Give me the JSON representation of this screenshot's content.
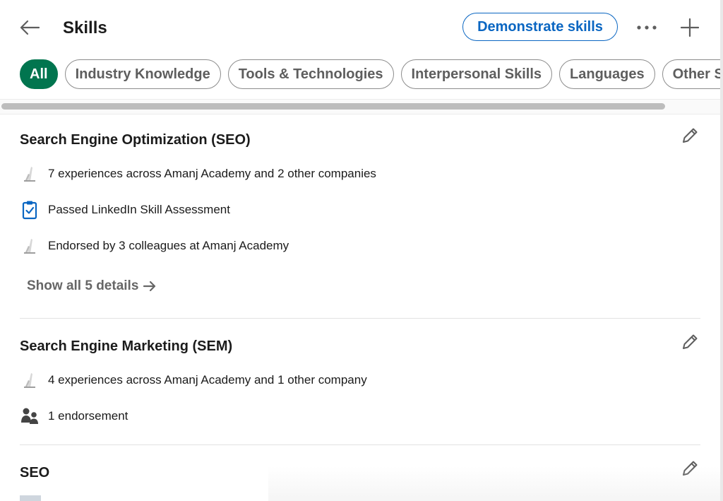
{
  "header": {
    "title": "Skills",
    "demonstrate_label": "Demonstrate skills"
  },
  "filters": [
    "All",
    "Industry Knowledge",
    "Tools & Technologies",
    "Interpersonal Skills",
    "Languages",
    "Other S"
  ],
  "skills": [
    {
      "title": "Search Engine Optimization (SEO)",
      "items": [
        {
          "icon": "company-logo-icon",
          "text": "7 experiences across Amanj Academy and 2 other companies"
        },
        {
          "icon": "assessment-clipboard-icon",
          "text": "Passed LinkedIn Skill Assessment"
        },
        {
          "icon": "company-logo-icon",
          "text": "Endorsed by 3 colleagues at Amanj Academy"
        }
      ],
      "show_all": "Show all 5 details"
    },
    {
      "title": "Search Engine Marketing (SEM)",
      "items": [
        {
          "icon": "company-logo-icon",
          "text": "4 experiences across Amanj Academy and 1 other company"
        },
        {
          "icon": "people-icon",
          "text": "1 endorsement"
        }
      ]
    },
    {
      "title": "SEO",
      "items": []
    }
  ],
  "colors": {
    "accent": "#0a66c2",
    "active_pill": "#01754f",
    "text": "#1b1b1b",
    "muted": "#666666"
  }
}
